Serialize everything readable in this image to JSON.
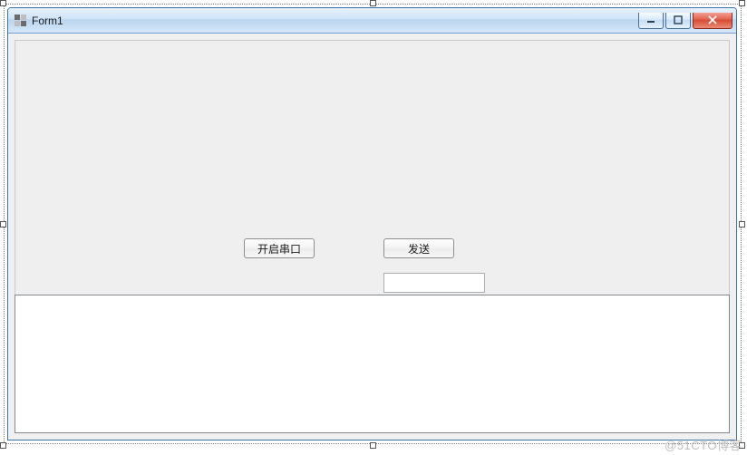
{
  "window": {
    "title": "Form1",
    "icon": "app-icon"
  },
  "controls": {
    "min": {
      "label": "Minimize"
    },
    "max": {
      "label": "Maximize"
    },
    "close": {
      "label": "Close"
    }
  },
  "buttons": {
    "open_serial": "开启串口",
    "send": "发送"
  },
  "inputs": {
    "send_text": {
      "value": "",
      "placeholder": ""
    }
  },
  "output": {
    "log": ""
  },
  "watermark": "@51CTO博客"
}
